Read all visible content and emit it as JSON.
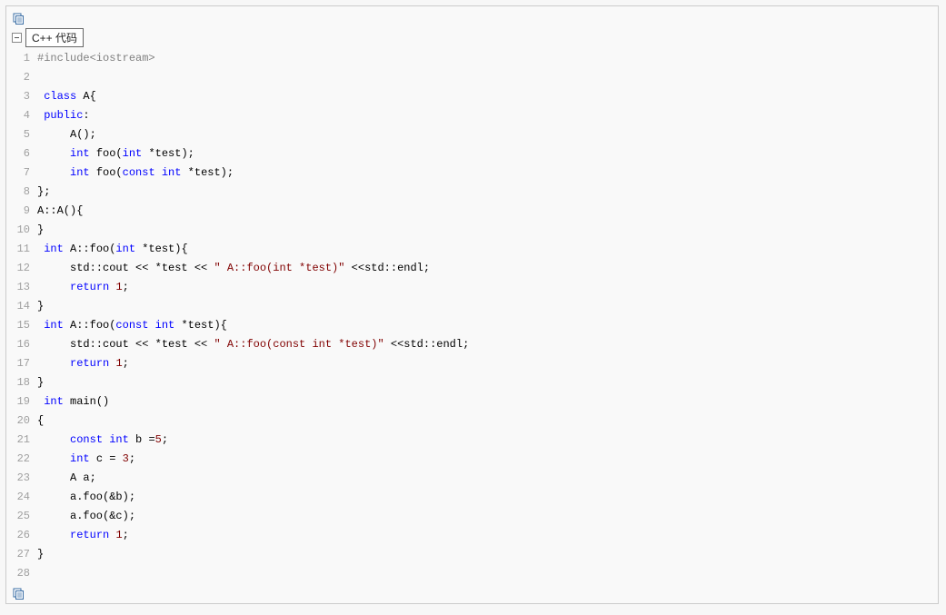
{
  "language_label": "C++ 代码",
  "collapse_glyph": "⊟",
  "code": [
    {
      "n": 1,
      "tokens": [
        [
          "#include<iostream>",
          "pp"
        ]
      ]
    },
    {
      "n": 2,
      "tokens": [
        [
          "",
          ""
        ]
      ]
    },
    {
      "n": 3,
      "tokens": [
        [
          " ",
          ""
        ],
        [
          "class",
          "kw"
        ],
        [
          " A{",
          ""
        ]
      ]
    },
    {
      "n": 4,
      "tokens": [
        [
          " ",
          ""
        ],
        [
          "public",
          "kw"
        ],
        [
          ":",
          ""
        ]
      ]
    },
    {
      "n": 5,
      "tokens": [
        [
          "     A();",
          ""
        ]
      ]
    },
    {
      "n": 6,
      "tokens": [
        [
          "     ",
          ""
        ],
        [
          "int",
          "kw"
        ],
        [
          " foo(",
          ""
        ],
        [
          "int",
          "kw"
        ],
        [
          " *test);",
          ""
        ]
      ]
    },
    {
      "n": 7,
      "tokens": [
        [
          "     ",
          ""
        ],
        [
          "int",
          "kw"
        ],
        [
          " foo(",
          ""
        ],
        [
          "const",
          "kw"
        ],
        [
          " ",
          ""
        ],
        [
          "int",
          "kw"
        ],
        [
          " *test);",
          ""
        ]
      ]
    },
    {
      "n": 8,
      "tokens": [
        [
          "};",
          ""
        ]
      ]
    },
    {
      "n": 9,
      "tokens": [
        [
          "A::A(){",
          ""
        ]
      ]
    },
    {
      "n": 10,
      "tokens": [
        [
          "}",
          ""
        ]
      ]
    },
    {
      "n": 11,
      "tokens": [
        [
          " ",
          ""
        ],
        [
          "int",
          "kw"
        ],
        [
          " A::foo(",
          ""
        ],
        [
          "int",
          "kw"
        ],
        [
          " *test){",
          ""
        ]
      ]
    },
    {
      "n": 12,
      "tokens": [
        [
          "     std::cout << *test << ",
          ""
        ],
        [
          "\" A::foo(int *test)\"",
          "str"
        ],
        [
          " <<std::endl;",
          ""
        ]
      ]
    },
    {
      "n": 13,
      "tokens": [
        [
          "     ",
          ""
        ],
        [
          "return",
          "kw"
        ],
        [
          " ",
          ""
        ],
        [
          "1",
          "num"
        ],
        [
          ";",
          ""
        ]
      ]
    },
    {
      "n": 14,
      "tokens": [
        [
          "}",
          ""
        ]
      ]
    },
    {
      "n": 15,
      "tokens": [
        [
          " ",
          ""
        ],
        [
          "int",
          "kw"
        ],
        [
          " A::foo(",
          ""
        ],
        [
          "const",
          "kw"
        ],
        [
          " ",
          ""
        ],
        [
          "int",
          "kw"
        ],
        [
          " *test){",
          ""
        ]
      ]
    },
    {
      "n": 16,
      "tokens": [
        [
          "     std::cout << *test << ",
          ""
        ],
        [
          "\" A::foo(const int *test)\"",
          "str"
        ],
        [
          " <<std::endl;",
          ""
        ]
      ]
    },
    {
      "n": 17,
      "tokens": [
        [
          "     ",
          ""
        ],
        [
          "return",
          "kw"
        ],
        [
          " ",
          ""
        ],
        [
          "1",
          "num"
        ],
        [
          ";",
          ""
        ]
      ]
    },
    {
      "n": 18,
      "tokens": [
        [
          "}",
          ""
        ]
      ]
    },
    {
      "n": 19,
      "tokens": [
        [
          " ",
          ""
        ],
        [
          "int",
          "kw"
        ],
        [
          " main()",
          ""
        ]
      ]
    },
    {
      "n": 20,
      "tokens": [
        [
          "{",
          ""
        ]
      ]
    },
    {
      "n": 21,
      "tokens": [
        [
          "     ",
          ""
        ],
        [
          "const",
          "kw"
        ],
        [
          " ",
          ""
        ],
        [
          "int",
          "kw"
        ],
        [
          " b =",
          ""
        ],
        [
          "5",
          "num"
        ],
        [
          ";",
          ""
        ]
      ]
    },
    {
      "n": 22,
      "tokens": [
        [
          "     ",
          ""
        ],
        [
          "int",
          "kw"
        ],
        [
          " c = ",
          ""
        ],
        [
          "3",
          "num"
        ],
        [
          ";",
          ""
        ]
      ]
    },
    {
      "n": 23,
      "tokens": [
        [
          "     A a;",
          ""
        ]
      ]
    },
    {
      "n": 24,
      "tokens": [
        [
          "     a.foo(&b);",
          ""
        ]
      ]
    },
    {
      "n": 25,
      "tokens": [
        [
          "     a.foo(&c);",
          ""
        ]
      ]
    },
    {
      "n": 26,
      "tokens": [
        [
          "     ",
          ""
        ],
        [
          "return",
          "kw"
        ],
        [
          " ",
          ""
        ],
        [
          "1",
          "num"
        ],
        [
          ";",
          ""
        ]
      ]
    },
    {
      "n": 27,
      "tokens": [
        [
          "}",
          ""
        ]
      ]
    },
    {
      "n": 28,
      "tokens": [
        [
          "",
          ""
        ]
      ]
    }
  ]
}
